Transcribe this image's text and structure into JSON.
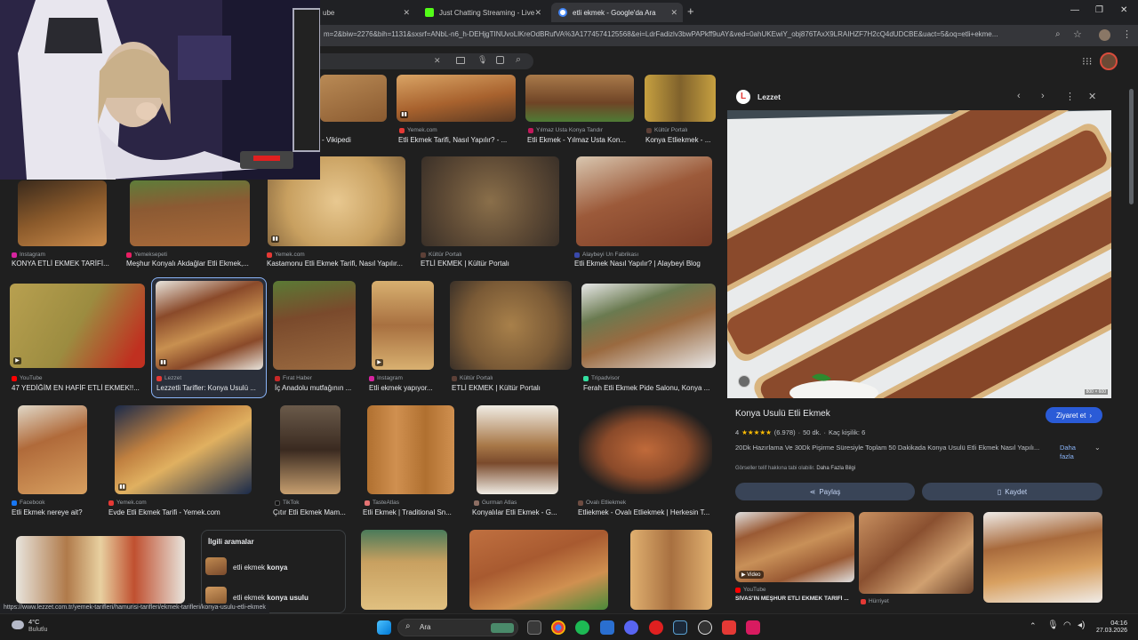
{
  "browser": {
    "tabs": [
      {
        "label": "ube"
      },
      {
        "label": "Just Chatting Streaming - Live"
      },
      {
        "label": "etli ekmek - Google'da Ara"
      }
    ],
    "new_tab": "+",
    "url": "m=2&biw=2276&bih=1131&sxsrf=ANbL-n6_h-DEHjgTINUvoLlKreOdBRufVA%3A1774574125568&ei=LdrFadizlv3bwPAPkff9uAY&ved=0ahUKEwiY_obj876TAxX9LRAIHZF7H2cQ4dUDCBE&uact=5&oq=etli+ekme..."
  },
  "results": [
    {
      "source": "",
      "title": "- Vikipedi"
    },
    {
      "source": "Yemek.com",
      "title": "Etli Ekmek Tarifi, Nasıl Yapılır? - ..."
    },
    {
      "source": "Yılmaz Usta Konya Tandır",
      "title": "Etli Ekmek - Yılmaz Usta Kon..."
    },
    {
      "source": "Kültür Portalı",
      "title": "Konya Etliekmek - ..."
    },
    {
      "source": "Instagram",
      "title": "KONYA ETLİ EKMEK TARİFİ..."
    },
    {
      "source": "Yemeksepeti",
      "title": "Meşhur Konyalı Akdağlar Etli Ekmek,..."
    },
    {
      "source": "Yemek.com",
      "title": "Kastamonu Etli Ekmek Tarifi, Nasıl Yapılır..."
    },
    {
      "source": "Kültür Portalı",
      "title": "ETLİ EKMEK | Kültür Portalı"
    },
    {
      "source": "Alaybeyi Un Fabrikası",
      "title": "Etli Ekmek Nasıl Yapılır? | Alaybeyi Blog"
    },
    {
      "source": "YouTube",
      "title": "47 YEDİĞİM EN HAFİF ETLİ EKMEK!!..."
    },
    {
      "source": "Lezzet",
      "title": "Lezzetli Tarifler: Konya Usulü ..."
    },
    {
      "source": "Fırat Haber",
      "title": "İç Anadolu mutfağının ..."
    },
    {
      "source": "Instagram",
      "title": "Etli ekmek yapıyor..."
    },
    {
      "source": "Kültür Portalı",
      "title": "ETLİ EKMEK | Kültür Portalı"
    },
    {
      "source": "Tripadvisor",
      "title": "Ferah Etli Ekmek Pide Salonu, Konya ..."
    },
    {
      "source": "Facebook",
      "title": "Etli Ekmek nereye ait?"
    },
    {
      "source": "Yemek.com",
      "title": "Evde Etli Ekmek Tarifi - Yemek.com"
    },
    {
      "source": "TikTok",
      "title": "Çıtır Etli Ekmek Mam..."
    },
    {
      "source": "TasteAtlas",
      "title": "Etli Ekmek | Traditional Sn..."
    },
    {
      "source": "Gurman Atlas",
      "title": "Konyalılar Etli Ekmek - G..."
    },
    {
      "source": "Ovalı Etliekmek",
      "title": "Etliekmek - Ovalı Etliekmek | Herkesin T..."
    }
  ],
  "related": {
    "heading": "İlgili aramalar",
    "items": [
      {
        "prefix": "etli ekmek ",
        "bold": "konya"
      },
      {
        "prefix": "etli ekmek ",
        "bold": "konya usulu"
      }
    ]
  },
  "panel": {
    "source": "Lezzet",
    "source_initial": "L",
    "image_size": "800 × 600",
    "title": "Konya Usulü Etli Ekmek",
    "visit": "Ziyaret et",
    "rating": "4",
    "stars": "★★★★★",
    "reviews": "(6.978)",
    "time": "50 dk.",
    "servings": "Kaç kişilik: 6",
    "description": "20Dk Hazırlama Ve 30Dk Pişirme Süresiyle Toplam 50 Dakikada Konya Usulü Etli Ekmek Nasıl Yapılı...",
    "more": "Daha fazla",
    "copyright": "Görseller telif hakkına tabi olabilir.",
    "copyright_more": "Daha Fazla Bilgi",
    "share": "Paylaş",
    "save": "Kaydet",
    "related_video_label": "Video",
    "related_source": "YouTube",
    "related_title": "SİVAS'IN MEŞHUR ETLİ EKMEK TARİFİ ...",
    "related_source2": "Hürriyet"
  },
  "status_url": "https://www.lezzet.com.tr/yemek-tarifleri/hamurisi-tarifleri/ekmek-tarifleri/konya-usulu-etli-ekmek",
  "taskbar": {
    "weather_temp": "4°C",
    "weather_desc": "Bulutlu",
    "search": "Ara",
    "time": "04:16",
    "date": "27.03.2026"
  },
  "colors": {
    "accent": "#8ab4f8",
    "button_bg": "#394457",
    "visit_bg": "#2a5bd7"
  }
}
